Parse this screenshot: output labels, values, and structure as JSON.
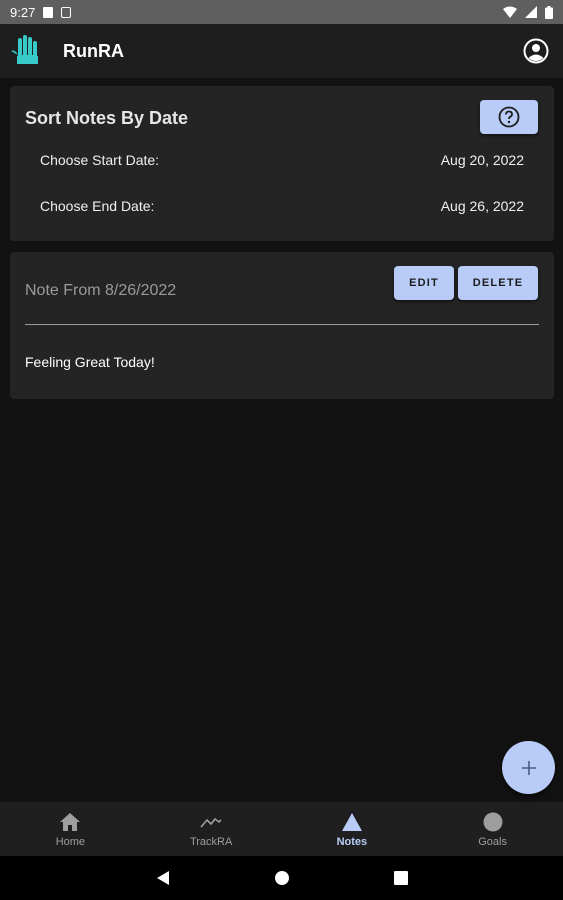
{
  "status_bar": {
    "time": "9:27"
  },
  "app_bar": {
    "title": "RunRA",
    "logo_text": "RunRA"
  },
  "sort_card": {
    "title": "Sort Notes By Date",
    "start_label": "Choose Start Date:",
    "start_value": "Aug 20, 2022",
    "end_label": "Choose End Date:",
    "end_value": "Aug 26, 2022"
  },
  "note_card": {
    "title": "Note From 8/26/2022",
    "edit_label": "EDIT",
    "delete_label": "DELETE",
    "body": "Feeling Great Today!"
  },
  "bottom_nav": {
    "items": [
      {
        "label": "Home",
        "icon": "home-icon"
      },
      {
        "label": "TrackRA",
        "icon": "trend-icon"
      },
      {
        "label": "Notes",
        "icon": "triangle-icon",
        "active": true
      },
      {
        "label": "Goals",
        "icon": "circle-icon"
      }
    ]
  },
  "colors": {
    "accent": "#b8ccf7",
    "card": "#242424",
    "background": "#121212",
    "logo": "#38c9c9"
  }
}
